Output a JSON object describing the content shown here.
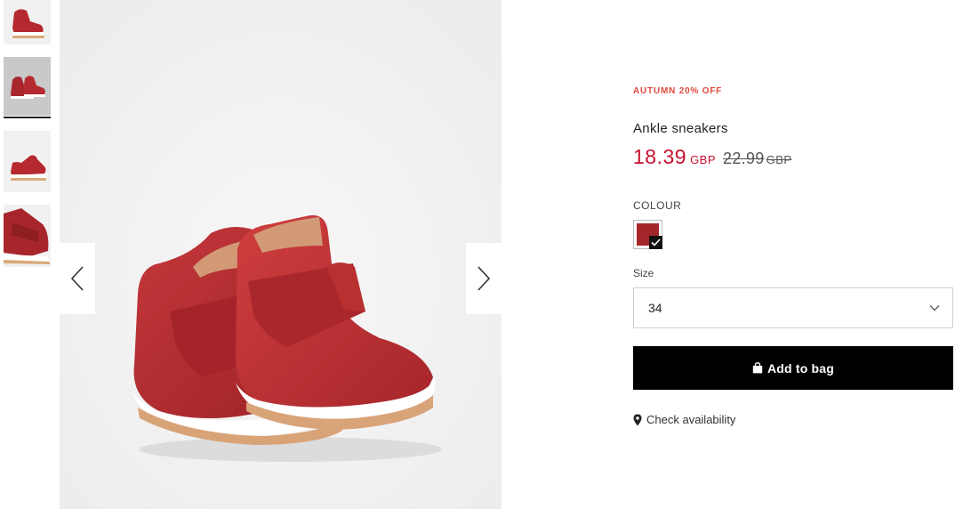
{
  "product": {
    "promo": "AUTUMN 20% OFF",
    "name": "Ankle sneakers",
    "price_now": "18.39",
    "currency_now": "GBP",
    "price_old": "22.99",
    "currency_old": "GBP"
  },
  "colour": {
    "label": "COLOUR",
    "selected_swatch": "#a5262a"
  },
  "size": {
    "label": "Size",
    "selected": "34"
  },
  "actions": {
    "add_to_bag": "Add to bag",
    "check_availability": "Check availability"
  },
  "gallery": {
    "thumbnail_count": 4,
    "active_thumbnail": 2
  },
  "icons": {
    "prev": "chevron-left-icon",
    "next": "chevron-right-icon",
    "bag": "shopping-bag-icon",
    "location": "map-pin-icon",
    "check": "check-icon",
    "dropdown": "chevron-down-icon"
  },
  "colors": {
    "promo": "#e2483d",
    "price": "#c8102e",
    "button": "#000000"
  }
}
